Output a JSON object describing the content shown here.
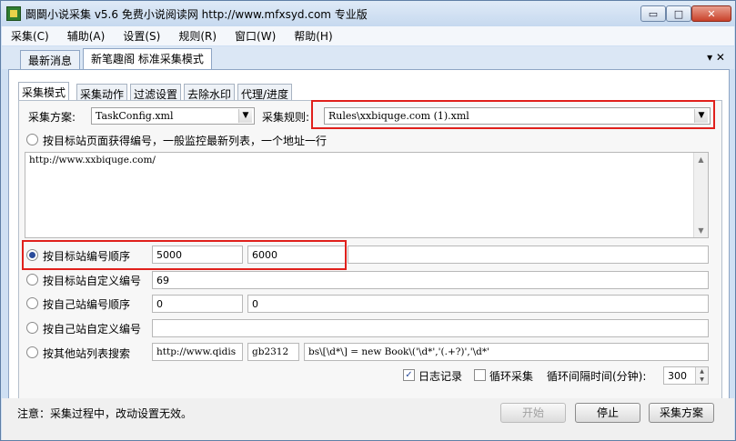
{
  "window": {
    "title": "鬬鬬小说采集 v5.6 免费小说阅读网 http://www.mfxsyd.com 专业版",
    "minimize_glyph": "▭",
    "maximize_glyph": "□",
    "close_glyph": "✕"
  },
  "menu": [
    "采集(C)",
    "辅助(A)",
    "设置(S)",
    "规则(R)",
    "窗口(W)",
    "帮助(H)"
  ],
  "outer_tabs": [
    {
      "label": "最新消息"
    },
    {
      "label": "新笔趣阁 标准采集模式",
      "active": true
    }
  ],
  "outer_tab_tools": "▾ ✕",
  "inner_tabs": [
    "采集模式",
    "采集动作",
    "过滤设置",
    "去除水印",
    "代理/进度"
  ],
  "config": {
    "scheme_label": "采集方案:",
    "scheme_value": "TaskConfig.xml",
    "rule_label": "采集规则:",
    "rule_value": "Rules\\xxbiquge.com  (1).xml"
  },
  "options": {
    "target_list": {
      "label": "按目标站页面获得编号，一般监控最新列表，一个地址一行",
      "urls": "http://www.xxbiquge.com/"
    },
    "target_seq": {
      "label": "按目标站编号顺序",
      "from": "5000",
      "to": "6000",
      "checked": true
    },
    "target_custom": {
      "label": "按目标站自定义编号",
      "value": "69"
    },
    "own_seq": {
      "label": "按自己站编号顺序",
      "from": "0",
      "to": "0"
    },
    "own_custom": {
      "label": "按自己站自定义编号",
      "value": ""
    },
    "other_search": {
      "label": "按其他站列表搜索",
      "url": "http://www.qidis",
      "encoding": "gb2312",
      "pattern": "bs\\[\\d*\\] = new Book\\('\\d*','(.+?)','\\d*'"
    }
  },
  "bottom": {
    "log_label": "日志记录",
    "log_checked": true,
    "loop_label": "循环采集",
    "loop_checked": false,
    "interval_label": "循环间隔时间(分钟):",
    "interval_value": "300"
  },
  "status": {
    "note": "注意：采集过程中，改动设置无效。",
    "start_button": "开始",
    "stop_button": "停止",
    "scheme_button": "采集方案"
  },
  "colors": {
    "highlight": "#e0201c",
    "radio_dot": "#2b4c9b"
  }
}
